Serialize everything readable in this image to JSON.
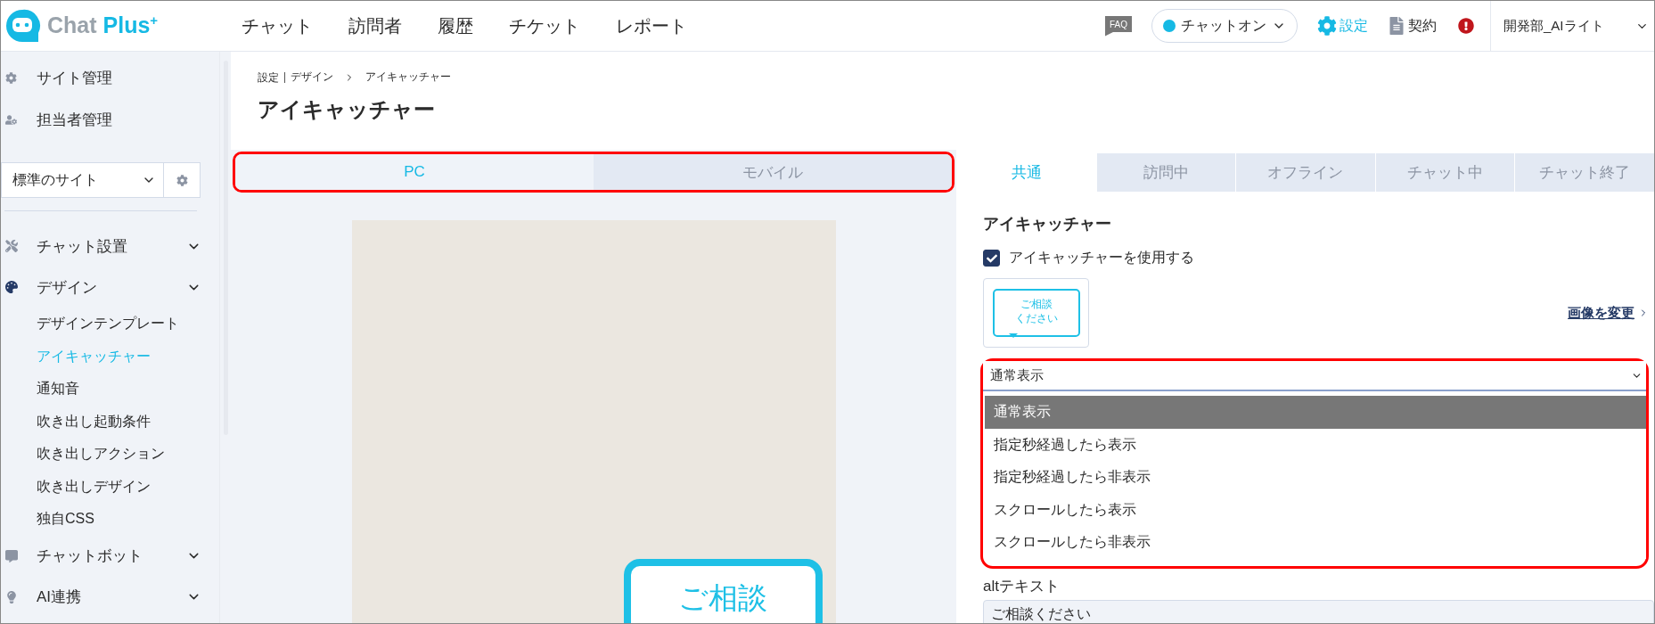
{
  "header": {
    "logo": {
      "name": "Chat",
      "accent": "Plus",
      "sup": "+"
    },
    "nav": [
      "チャット",
      "訪問者",
      "履歴",
      "チケット",
      "レポート"
    ],
    "faq": "FAQ",
    "status": {
      "label": "チャットオン",
      "on": true
    },
    "settings": "設定",
    "contract": "契約",
    "user": "開発部_AIライト"
  },
  "sidebar": {
    "admin_items": [
      "サイト管理",
      "担当者管理"
    ],
    "site_select": {
      "value": "標準のサイト"
    },
    "sections": [
      {
        "label": "チャット設置"
      },
      {
        "label": "デザイン",
        "children": [
          {
            "label": "デザインテンプレート",
            "selected": false
          },
          {
            "label": "アイキャッチャー",
            "selected": true
          },
          {
            "label": "通知音",
            "selected": false
          },
          {
            "label": "吹き出し起動条件",
            "selected": false
          },
          {
            "label": "吹き出しアクション",
            "selected": false
          },
          {
            "label": "吹き出しデザイン",
            "selected": false
          },
          {
            "label": "独自CSS",
            "selected": false
          }
        ]
      },
      {
        "label": "チャットボット"
      },
      {
        "label": "AI連携"
      }
    ]
  },
  "breadcrumb": [
    "設定",
    "デザイン",
    "アイキャッチャー"
  ],
  "page_title": "アイキャッチャー",
  "device_tabs": [
    {
      "label": "PC",
      "selected": true
    },
    {
      "label": "モバイル",
      "selected": false
    }
  ],
  "preview": {
    "bubble_text": "ご相談"
  },
  "state_tabs": [
    {
      "label": "共通",
      "selected": true
    },
    {
      "label": "訪問中",
      "selected": false
    },
    {
      "label": "オフライン",
      "selected": false
    },
    {
      "label": "チャット中",
      "selected": false
    },
    {
      "label": "チャット終了",
      "selected": false
    }
  ],
  "settings_panel": {
    "heading": "アイキャッチャー",
    "use_checkbox": {
      "label": "アイキャッチャーを使用する",
      "checked": true
    },
    "thumbnail": [
      "ご相談",
      "ください"
    ],
    "change_link": "画像を変更",
    "display_select": {
      "value": "通常表示",
      "expanded": true,
      "options": [
        {
          "label": "通常表示",
          "selected": true
        },
        {
          "label": "指定秒経過したら表示",
          "selected": false
        },
        {
          "label": "指定秒経過したら非表示",
          "selected": false
        },
        {
          "label": "スクロールしたら表示",
          "selected": false
        },
        {
          "label": "スクロールしたら非表示",
          "selected": false
        }
      ]
    },
    "alt_text": {
      "label": "altテキスト",
      "value": "ご相談ください"
    }
  }
}
